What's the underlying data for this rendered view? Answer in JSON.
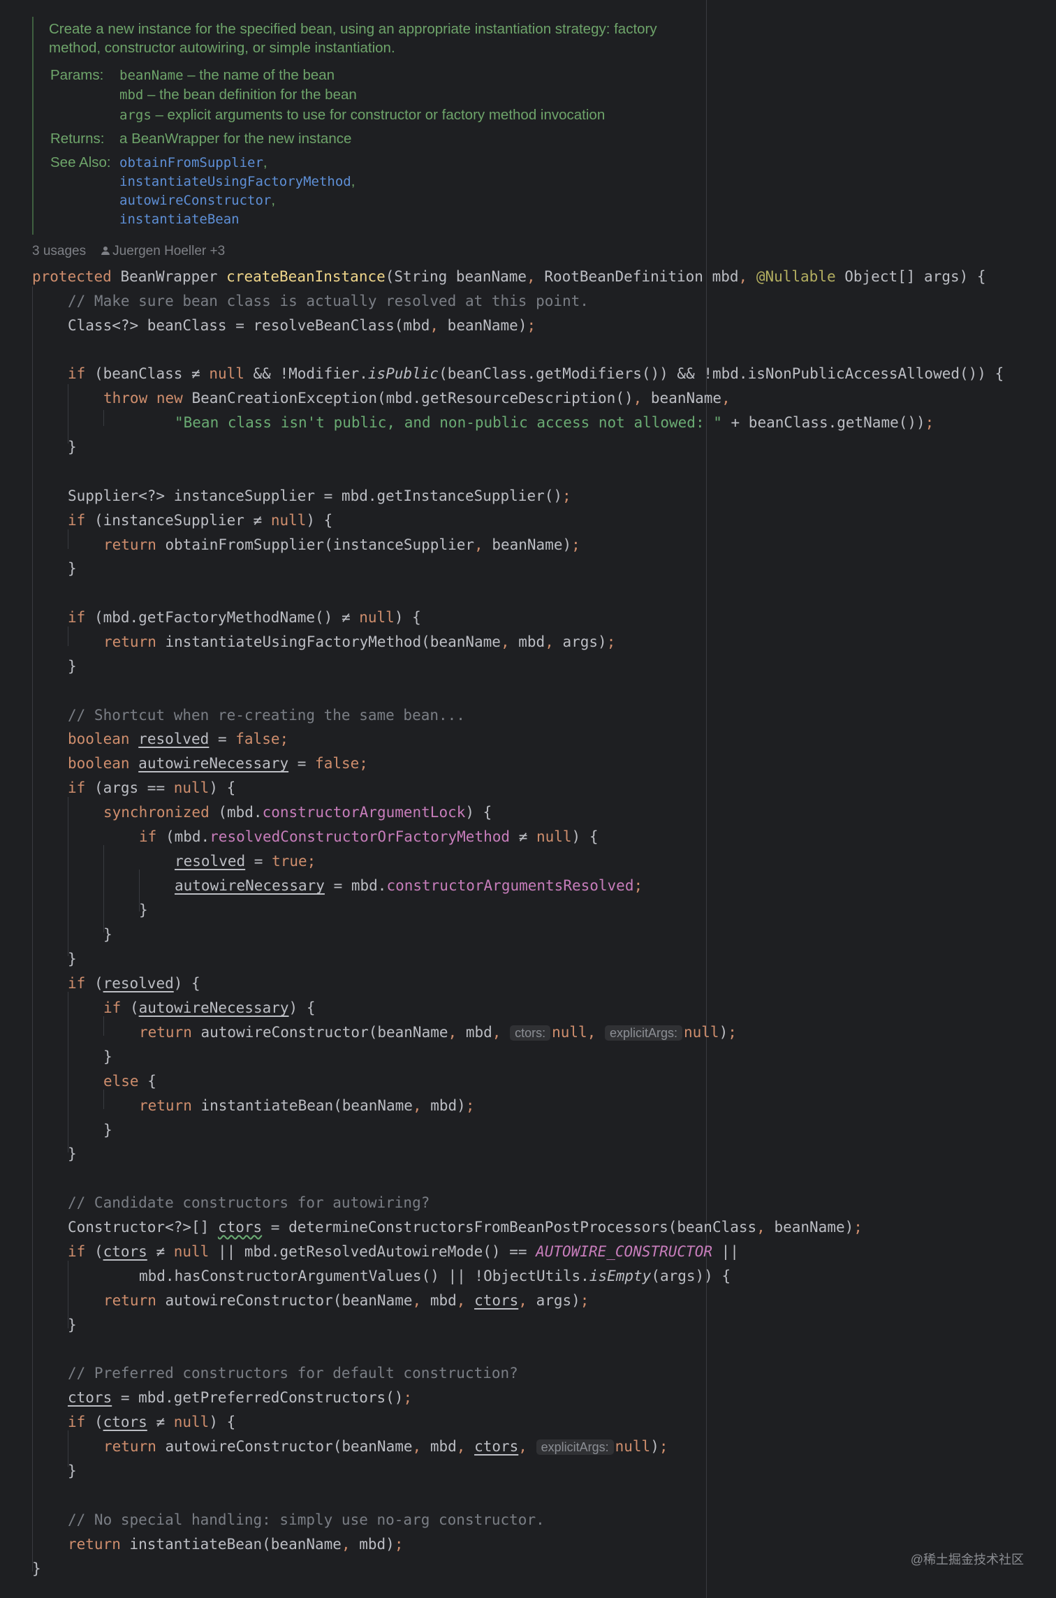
{
  "javadoc": {
    "description_line1": "Create a new instance for the specified bean, using an appropriate instantiation strategy: factory",
    "description_line2": "method, constructor autowiring, or simple instantiation.",
    "params_label": "Params:",
    "params": [
      {
        "name": "beanName",
        "desc": " – the name of the bean"
      },
      {
        "name": "mbd",
        "desc": " – the bean definition for the bean"
      },
      {
        "name": "args",
        "desc": " – explicit arguments to use for constructor or factory method invocation"
      }
    ],
    "returns_label": "Returns:",
    "returns": "a BeanWrapper for the new instance",
    "see_also_label": "See Also:",
    "see_also": [
      "obtainFromSupplier",
      "instantiateUsingFactoryMethod",
      "autowireConstructor",
      "instantiateBean"
    ],
    "comma": ","
  },
  "usages": {
    "count": "3 usages",
    "author": "Juergen Hoeller +3"
  },
  "code": {
    "l1": {
      "kw": "protected",
      "a": " BeanWrapper ",
      "method": "createBeanInstance",
      "b": "(String beanName",
      "c1": ",",
      "c": " RootBeanDefinition mbd",
      "c2": ",",
      "d": " ",
      "ann": "@Nullable",
      "e": " Object[] args) {"
    },
    "l2": {
      "comment": "// Make sure bean class is actually resolved at this point."
    },
    "l3": {
      "a": "Class<?> beanClass = resolveBeanClass(mbd",
      "c1": ",",
      "b": " beanName)",
      "semi": ";"
    },
    "l4": {
      "kw": "if",
      "a": " (beanClass ≠ ",
      "kn": "null",
      "b": " && !Modifier.",
      "it": "isPublic",
      "c": "(beanClass.getModifiers()) && !mbd.isNonPublicAccessAllowed()) {"
    },
    "l5": {
      "kw1": "throw",
      "sp": " ",
      "kw2": "new",
      "a": " BeanCreationException(mbd.getResourceDescription()",
      "c1": ",",
      "b": " beanName",
      "c2": ","
    },
    "l6": {
      "str": "\"Bean class isn't public, and non-public access not allowed: \"",
      "a": " + beanClass.getName())",
      "semi": ";"
    },
    "l7": {
      "a": "}"
    },
    "l8": {
      "a": "Supplier<?> instanceSupplier = mbd.getInstanceSupplier()",
      "semi": ";"
    },
    "l9": {
      "kw": "if",
      "a": " (instanceSupplier ≠ ",
      "kn": "null",
      "b": ") {"
    },
    "l10": {
      "kw": "return",
      "a": " obtainFromSupplier(instanceSupplier",
      "c1": ",",
      "b": " beanName)",
      "semi": ";"
    },
    "l11": {
      "a": "}"
    },
    "l12": {
      "kw": "if",
      "a": " (mbd.getFactoryMethodName() ≠ ",
      "kn": "null",
      "b": ") {"
    },
    "l13": {
      "kw": "return",
      "a": " instantiateUsingFactoryMethod(beanName",
      "c1": ",",
      "b": " mbd",
      "c2": ",",
      "c": " args)",
      "semi": ";"
    },
    "l14": {
      "a": "}"
    },
    "l15": {
      "comment": "// Shortcut when re-creating the same bean..."
    },
    "l16": {
      "kw": "boolean",
      "sp": " ",
      "var": "resolved",
      "a": " = ",
      "kv": "false",
      "semi": ";"
    },
    "l17": {
      "kw": "boolean",
      "sp": " ",
      "var": "autowireNecessary",
      "a": " = ",
      "kv": "false",
      "semi": ";"
    },
    "l18": {
      "kw": "if",
      "a": " (args == ",
      "kn": "null",
      "b": ") {"
    },
    "l19": {
      "kw": "synchronized",
      "a": " (mbd.",
      "fld": "constructorArgumentLock",
      "b": ") {"
    },
    "l20": {
      "kw": "if",
      "a": " (mbd.",
      "fld": "resolvedConstructorOrFactoryMethod",
      "b": " ≠ ",
      "kn": "null",
      "c": ") {"
    },
    "l21": {
      "var": "resolved",
      "a": " = ",
      "kv": "true",
      "semi": ";"
    },
    "l22": {
      "var": "autowireNecessary",
      "a": " = mbd.",
      "fld": "constructorArgumentsResolved",
      "semi": ";"
    },
    "l23": {
      "a": "}"
    },
    "l24": {
      "a": "}"
    },
    "l25": {
      "a": "}"
    },
    "l26": {
      "kw": "if",
      "a": " (",
      "var": "resolved",
      "b": ") {"
    },
    "l27": {
      "kw": "if",
      "a": " (",
      "var": "autowireNecessary",
      "b": ") {"
    },
    "l28": {
      "kw": "return",
      "a": " autowireConstructor(beanName",
      "c1": ",",
      "b": " mbd",
      "c2": ",",
      "sp": " ",
      "h1": "ctors:",
      "kn1": "null",
      "c3": ",",
      "sp2": " ",
      "h2": "explicitArgs:",
      "kn2": "null",
      "c": ")",
      "semi": ";"
    },
    "l29": {
      "a": "}"
    },
    "l30": {
      "kw": "else",
      "a": " {"
    },
    "l31": {
      "kw": "return",
      "a": " instantiateBean(beanName",
      "c1": ",",
      "b": " mbd)",
      "semi": ";"
    },
    "l32": {
      "a": "}"
    },
    "l33": {
      "a": "}"
    },
    "l34": {
      "comment": "// Candidate constructors for autowiring?"
    },
    "l35": {
      "a": "Constructor<?>[] ",
      "var": "ctors",
      "b": " = determineConstructorsFromBeanPostProcessors(beanClass",
      "c1": ",",
      "c": " beanName)",
      "semi": ";"
    },
    "l36": {
      "kw": "if",
      "a": " (",
      "var": "ctors",
      "b": " ≠ ",
      "kn": "null",
      "c": " || mbd.getResolvedAutowireMode() == ",
      "st": "AUTOWIRE_CONSTRUCTOR",
      "d": " ||"
    },
    "l37": {
      "a": "mbd.hasConstructorArgumentValues() || !ObjectUtils.",
      "it": "isEmpty",
      "b": "(args)) {"
    },
    "l38": {
      "kw": "return",
      "a": " autowireConstructor(beanName",
      "c1": ",",
      "b": " mbd",
      "c2": ",",
      "sp": " ",
      "var": "ctors",
      "c3": ",",
      "c": " args)",
      "semi": ";"
    },
    "l39": {
      "a": "}"
    },
    "l40": {
      "comment": "// Preferred constructors for default construction?"
    },
    "l41": {
      "var": "ctors",
      "a": " = mbd.getPreferredConstructors()",
      "semi": ";"
    },
    "l42": {
      "kw": "if",
      "a": " (",
      "var": "ctors",
      "b": " ≠ ",
      "kn": "null",
      "c": ") {"
    },
    "l43": {
      "kw": "return",
      "a": " autowireConstructor(beanName",
      "c1": ",",
      "b": " mbd",
      "c2": ",",
      "sp": " ",
      "var": "ctors",
      "c3": ",",
      "sp2": " ",
      "h2": "explicitArgs:",
      "kn2": "null",
      "c": ")",
      "semi": ";"
    },
    "l44": {
      "a": "}"
    },
    "l45": {
      "comment": "// No special handling: simply use no-arg constructor."
    },
    "l46": {
      "kw": "return",
      "a": " instantiateBean(beanName",
      "c1": ",",
      "b": " mbd)",
      "semi": ";"
    },
    "l47": {
      "a": "}"
    }
  },
  "watermark": "@稀土掘金技术社区",
  "colors": {
    "background": "#1e1f22",
    "keyword": "#cf8e6d",
    "method_declaration": "#f0d68a",
    "annotation": "#b3ae60",
    "field": "#c77dbb",
    "string": "#6aab73",
    "comment": "#7a7e85",
    "doc_text": "#6ea46a",
    "doc_link": "#5e8fd6",
    "plain_text": "#bcbec4"
  }
}
